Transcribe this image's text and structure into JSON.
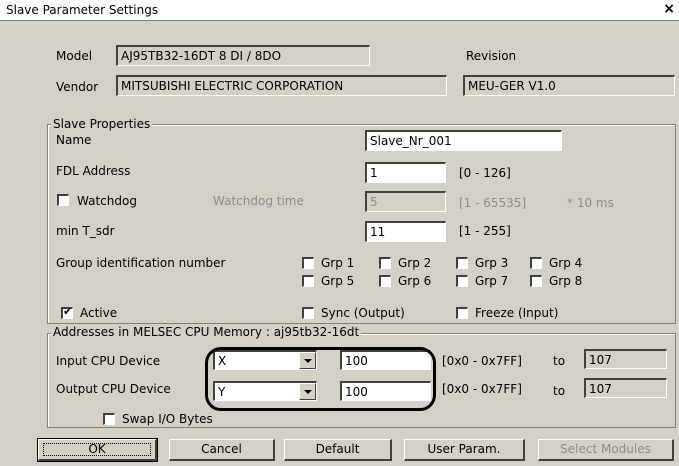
{
  "window": {
    "title": "Slave Parameter Settings",
    "close_glyph": "×"
  },
  "info": {
    "model_label": "Model",
    "model_value": "AJ95TB32-16DT  8 DI / 8DO",
    "vendor_label": "Vendor",
    "vendor_value": "MITSUBISHI ELECTRIC CORPORATION",
    "revision_label": "Revision",
    "revision_value": "MEU-GER V1.0"
  },
  "slave_props": {
    "group_title": "Slave Properties",
    "name_label": "Name",
    "name_value": "Slave_Nr_001",
    "fdl_label": "FDL Address",
    "fdl_value": "1",
    "fdl_range": "[0 - 126]",
    "watchdog_label": "Watchdog",
    "watchdog_checked": false,
    "watchdog_time_label": "Watchdog time",
    "watchdog_time_value": "5",
    "watchdog_time_range": "[1 - 65535]",
    "watchdog_unit": "* 10 ms",
    "mintsdr_label": "min T_sdr",
    "mintsdr_value": "11",
    "mintsdr_range": "[1 - 255]",
    "group_id_label": "Group identification number",
    "groups": [
      "Grp 1",
      "Grp 2",
      "Grp 3",
      "Grp 4",
      "Grp 5",
      "Grp 6",
      "Grp 7",
      "Grp 8"
    ],
    "active_label": "Active",
    "active_checked": true,
    "sync_label": "Sync (Output)",
    "freeze_label": "Freeze (Input)"
  },
  "addresses": {
    "group_title": "Addresses in MELSEC CPU Memory : aj95tb32-16dt",
    "input_label": "Input CPU Device",
    "input_device": "X",
    "input_start": "100",
    "input_range": "[0x0 - 0x7FF]",
    "input_to": "to",
    "input_end": "107",
    "output_label": "Output CPU Device",
    "output_device": "Y",
    "output_start": "100",
    "output_range": "[0x0 - 0x7FF]",
    "output_to": "to",
    "output_end": "107",
    "swap_label": "Swap I/O Bytes",
    "swap_checked": false
  },
  "buttons": {
    "ok": "OK",
    "cancel": "Cancel",
    "default": "Default",
    "user_param": "User Param.",
    "select_modules": "Select Modules"
  },
  "icons": {
    "check": "✔"
  }
}
